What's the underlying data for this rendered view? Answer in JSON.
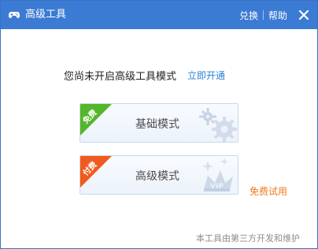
{
  "window": {
    "title": "高级工具",
    "actions": {
      "redeem_label": "兑换",
      "help_label": "帮助"
    }
  },
  "content": {
    "message": "您尚未开启高级工具模式",
    "open_now_link": "立即开通",
    "cards": [
      {
        "ribbon_label": "免费",
        "label": "基础模式",
        "ribbon_color": "#54b62a",
        "art_icon": "gear-icon"
      },
      {
        "ribbon_label": "付费",
        "label": "高级模式",
        "ribbon_color": "#f15a1d",
        "art_icon": "vip-icon"
      }
    ],
    "trial_link": "免费试用",
    "footer_note": "本工具由第三方开发和维护"
  },
  "colors": {
    "titlebar": "#3c7bd3",
    "link_blue": "#2f80d8",
    "trial_orange": "#f07a1b"
  }
}
